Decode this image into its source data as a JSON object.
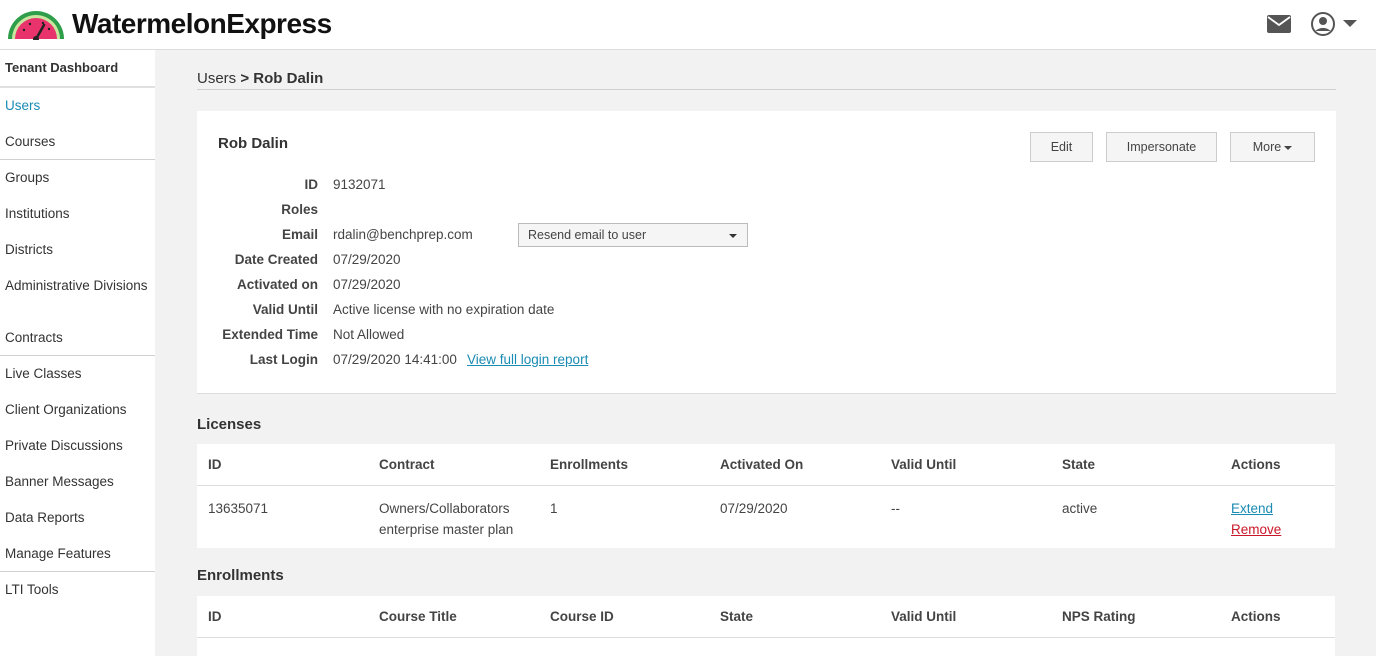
{
  "header": {
    "brand": "WatermelonExpress",
    "icons": [
      "watermelon-gauge-logo",
      "mail-icon",
      "user-circle-icon",
      "caret-down-icon"
    ]
  },
  "sidebar": {
    "title": "Tenant Dashboard",
    "items": [
      {
        "label": "Users"
      },
      {
        "label": "Courses"
      },
      {
        "label": "Groups"
      },
      {
        "label": "Institutions"
      },
      {
        "label": "Districts"
      },
      {
        "label": "Administrative Divisions"
      },
      {
        "label": "Contracts"
      },
      {
        "label": "Live Classes"
      },
      {
        "label": "Client Organizations"
      },
      {
        "label": "Private Discussions"
      },
      {
        "label": "Banner Messages"
      },
      {
        "label": "Data Reports"
      },
      {
        "label": "Manage Features"
      },
      {
        "label": "LTI Tools"
      }
    ]
  },
  "breadcrumb": {
    "parent": "Users",
    "separator": " > ",
    "current": "Rob Dalin"
  },
  "user": {
    "name": "Rob Dalin",
    "buttons": {
      "edit": "Edit",
      "impersonate": "Impersonate",
      "more": "More"
    },
    "fields": {
      "id": {
        "label": "ID",
        "value": "9132071"
      },
      "roles": {
        "label": "Roles",
        "value": ""
      },
      "email": {
        "label": "Email",
        "value": "rdalin@benchprep.com"
      },
      "date_created": {
        "label": "Date Created",
        "value": "07/29/2020"
      },
      "activated_on": {
        "label": "Activated on",
        "value": "07/29/2020"
      },
      "valid_until": {
        "label": "Valid Until",
        "value": "Active license with no expiration date"
      },
      "extended_time": {
        "label": "Extended Time",
        "value": "Not Allowed"
      },
      "last_login": {
        "label": "Last Login",
        "value": "07/29/2020 14:41:00",
        "link": "View full login report"
      }
    },
    "resend_select": "Resend email to user"
  },
  "licenses": {
    "title": "Licenses",
    "columns": [
      "ID",
      "Contract",
      "Enrollments",
      "Activated On",
      "Valid Until",
      "State",
      "Actions"
    ],
    "rows": [
      {
        "id": "13635071",
        "contract_line1": "Owners/Collaborators",
        "contract_line2": "enterprise master plan",
        "enrollments": "1",
        "activated_on": "07/29/2020",
        "valid_until": "--",
        "state": "active",
        "action_extend": "Extend",
        "action_remove": "Remove"
      }
    ]
  },
  "enrollments": {
    "title": "Enrollments",
    "columns": [
      "ID",
      "Course Title",
      "Course ID",
      "State",
      "Valid Until",
      "NPS Rating",
      "Actions"
    ]
  },
  "colors": {
    "accent": "#1a8bb3",
    "danger": "#c9172a",
    "watermelon": "#e8336d",
    "rind": "#2e9e4a"
  }
}
